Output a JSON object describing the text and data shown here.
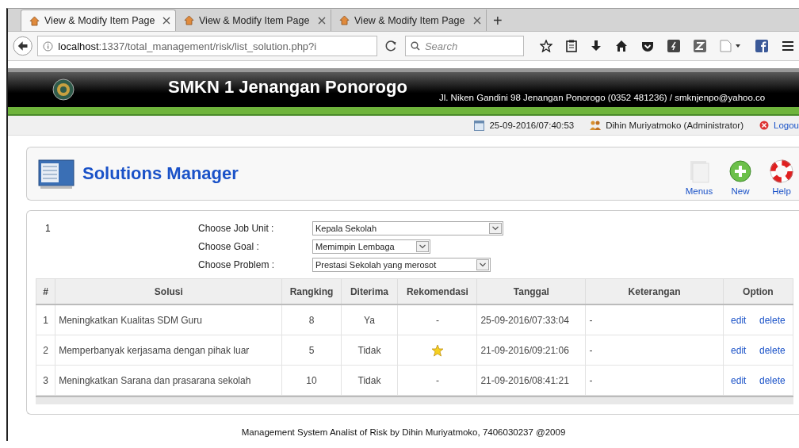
{
  "browser": {
    "tabs": [
      {
        "title": "View & Modify Item Page",
        "selected": true
      },
      {
        "title": "View & Modify Item Page",
        "selected": false
      },
      {
        "title": "View & Modify Item Page",
        "selected": false
      }
    ],
    "new_tab": "+",
    "url_host": "localhost",
    "url_path": ":1337/total_management/risk/list_solution.php?i",
    "search_placeholder": "Search"
  },
  "header": {
    "school": "SMKN 1 Jenangan Ponorogo",
    "address": "Jl. Niken Gandini 98 Jenangan Ponorogo (0352 481236) / smknjenpo@yahoo.co"
  },
  "info_bar": {
    "datetime": "25-09-2016/07:40:53",
    "user": "Dihin Muriyatmoko (Administrator)",
    "logout": "Logou"
  },
  "manager": {
    "title": "Solutions Manager",
    "actions": [
      {
        "label": "Menus"
      },
      {
        "label": "New"
      },
      {
        "label": "Help"
      }
    ]
  },
  "filters": {
    "counter": "1",
    "fields": [
      {
        "label": "Choose Job Unit :",
        "value": "Kepala Sekolah"
      },
      {
        "label": "Choose Goal :",
        "value": "Memimpin Lembaga"
      },
      {
        "label": "Choose Problem :",
        "value": "Prestasi Sekolah yang merosot"
      }
    ]
  },
  "table": {
    "columns": [
      "#",
      "Solusi",
      "Rangking",
      "Diterima",
      "Rekomendasi",
      "Tanggal",
      "Keterangan",
      "Option"
    ],
    "rows": [
      {
        "no": "1",
        "solusi": "Meningkatkan Kualitas SDM Guru",
        "rangking": "8",
        "diterima": "Ya",
        "recommended": false,
        "rekomendasi": "-",
        "tanggal": "25-09-2016/07:33:04",
        "keterangan": "-",
        "actions": [
          "edit",
          "delete"
        ]
      },
      {
        "no": "2",
        "solusi": "Memperbanyak kerjasama dengan pihak luar",
        "rangking": "5",
        "diterima": "Tidak",
        "recommended": true,
        "tanggal": "21-09-2016/09:21:06",
        "keterangan": "-",
        "actions": [
          "edit",
          "delete"
        ]
      },
      {
        "no": "3",
        "solusi": "Meningkatkan Sarana dan prasarana sekolah",
        "rangking": "10",
        "diterima": "Tidak",
        "recommended": false,
        "rekomendasi": "-",
        "tanggal": "21-09-2016/08:41:21",
        "keterangan": "-",
        "actions": [
          "edit",
          "delete"
        ]
      }
    ]
  },
  "footer": "Management System Analist of Risk by Dihin Muriyatmoko, 7406030237 @2009"
}
